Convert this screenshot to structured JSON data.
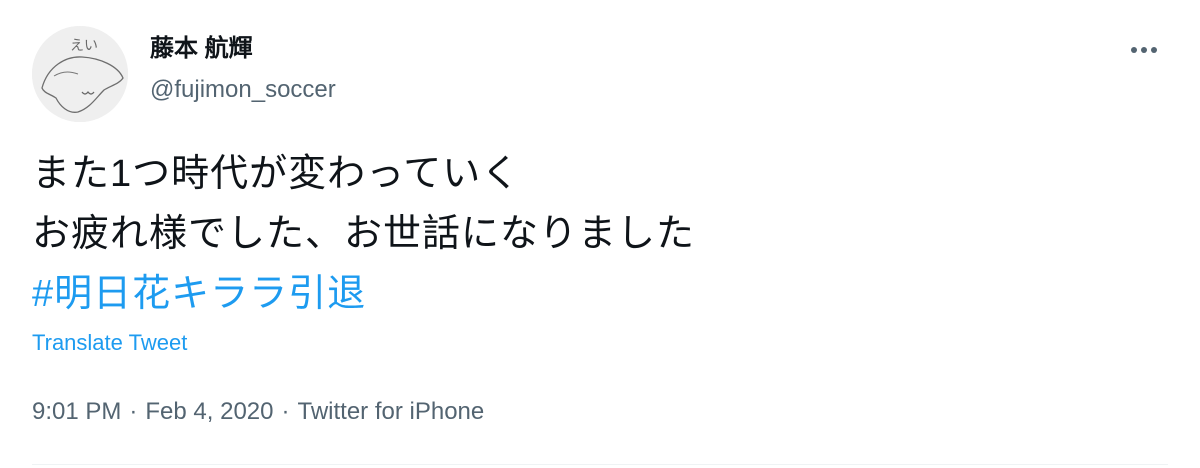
{
  "author": {
    "display_name": "藤本 航輝",
    "handle": "@fujimon_soccer",
    "avatar_icon": "hand-drawn-face-avatar",
    "avatar_text": "えい"
  },
  "tweet": {
    "lines": [
      "また1つ時代が変わっていく",
      "お疲れ様でした、お世話になりました"
    ],
    "hashtag": "#明日花キララ引退",
    "translate_label": "Translate Tweet"
  },
  "meta": {
    "time": "9:01 PM",
    "date": "Feb 4, 2020",
    "source": "Twitter for iPhone",
    "separator": "·"
  },
  "more_icon": "more-horizontal-icon",
  "colors": {
    "text": "#0f1419",
    "secondary": "#536471",
    "accent": "#1d9bf0",
    "divider": "#eff3f4"
  }
}
